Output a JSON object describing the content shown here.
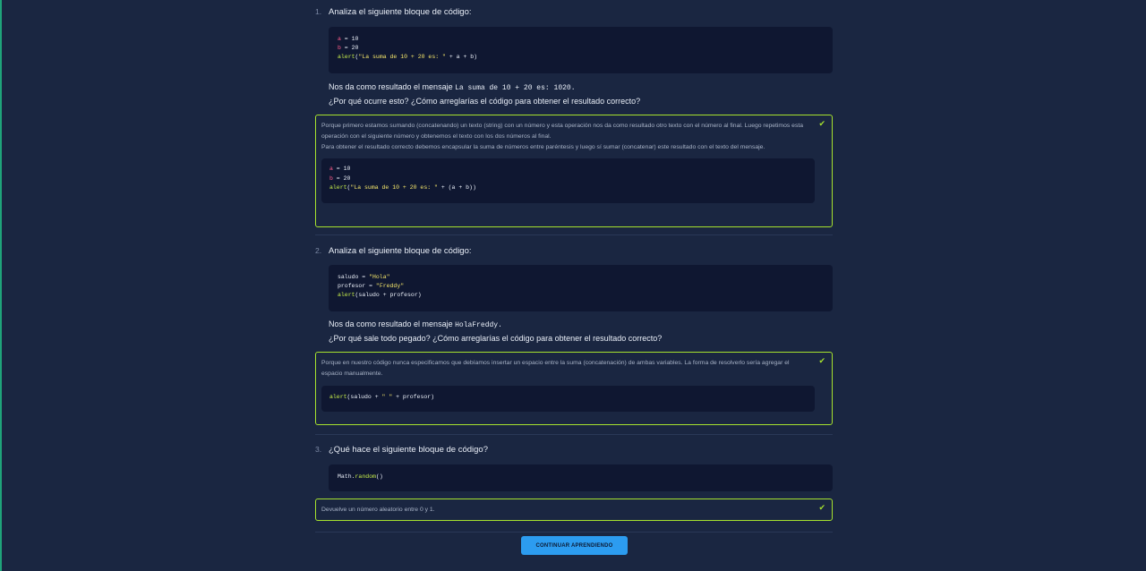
{
  "questions": [
    {
      "number": "1.",
      "title": "Analiza el siguiente bloque de código:",
      "code_lines": [
        [
          {
            "t": "a",
            "c": "pk"
          },
          {
            "t": " = 10"
          }
        ],
        [
          {
            "t": "b",
            "c": "pk"
          },
          {
            "t": " = 20"
          }
        ],
        [
          {
            "t": "alert",
            "c": "gr"
          },
          {
            "t": "("
          },
          {
            "t": "\"La suma de 10 + 20 es: \"",
            "c": "st"
          },
          {
            "t": " + a + b)"
          }
        ]
      ],
      "result_prefix": "Nos da como resultado el mensaje",
      "result_code": "La suma de 10 + 20 es: 1020.",
      "result_suffix": "",
      "question_line": "¿Por qué ocurre esto? ¿Cómo arreglarías el código para obtener el resultado correcto?",
      "answer_paragraphs": [
        "Porque primero estamos sumando (concatenando) un texto (string) con un número y esta operación nos da como resultado otro texto con el número al final. Luego repetimos esta operación con el siguiente número y obtenemos el texto con los dos números al final.",
        "Para obtener el resultado correcto debemos encapsular la suma de números entre paréntesis y luego sí sumar (concatenar) este resultado con el texto del mensaje."
      ],
      "answer_code_lines": [
        [
          {
            "t": "a",
            "c": "pk"
          },
          {
            "t": " = 10"
          }
        ],
        [
          {
            "t": "b",
            "c": "pk"
          },
          {
            "t": " = 20"
          }
        ],
        [
          {
            "t": "alert",
            "c": "gr"
          },
          {
            "t": "("
          },
          {
            "t": "\"La suma de 10 + 20 es: \"",
            "c": "st"
          },
          {
            "t": " + (a + b))"
          }
        ]
      ]
    },
    {
      "number": "2.",
      "title": "Analiza el siguiente bloque de código:",
      "code_lines": [
        [
          {
            "t": "saludo = "
          },
          {
            "t": "\"Hola\"",
            "c": "st"
          }
        ],
        [
          {
            "t": "profesor = "
          },
          {
            "t": "\"Freddy\"",
            "c": "st"
          }
        ],
        [
          {
            "t": "alert",
            "c": "gr"
          },
          {
            "t": "(saludo + profesor)"
          }
        ]
      ],
      "result_prefix": "Nos da como resultado el mensaje",
      "result_code": "HolaFreddy.",
      "result_suffix": "",
      "question_line": "¿Por qué sale todo pegado? ¿Cómo arreglarías el código para obtener el resultado correcto?",
      "answer_paragraphs": [
        "Porque en nuestro código nunca especificamos que debíamos insertar un espacio entre la suma (concatenación) de ambas variables. La forma de resolverlo sería agregar el espacio manualmente."
      ],
      "answer_code_lines": [
        [
          {
            "t": "alert",
            "c": "gr"
          },
          {
            "t": "(saludo + "
          },
          {
            "t": "\" \"",
            "c": "st"
          },
          {
            "t": " + profesor)"
          }
        ]
      ]
    },
    {
      "number": "3.",
      "title": "¿Qué hace el siguiente bloque de código?",
      "code_lines": [
        [
          {
            "t": "Math."
          },
          {
            "t": "random",
            "c": "gr"
          },
          {
            "t": "()"
          }
        ]
      ],
      "answer_paragraphs": [
        "Devuelve un número aleatorio entre 0 y 1."
      ]
    }
  ],
  "check_icon": "check-icon",
  "continue_button": "CONTINUAR APRENDIENDO",
  "colors": {
    "background": "#1a2641",
    "code_background": "#0f1731",
    "answer_border": "#a6e22e",
    "button": "#2c9cf0"
  }
}
